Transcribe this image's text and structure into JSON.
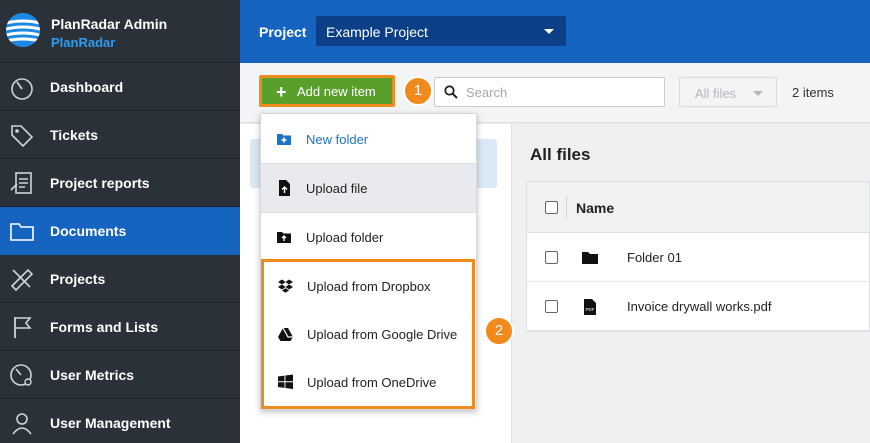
{
  "app": {
    "name": "PlanRadar Admin",
    "sub": "PlanRadar"
  },
  "sidebar": {
    "items": [
      {
        "label": "Dashboard",
        "icon": "gauge-icon"
      },
      {
        "label": "Tickets",
        "icon": "tag-icon"
      },
      {
        "label": "Project reports",
        "icon": "report-icon"
      },
      {
        "label": "Documents",
        "icon": "folder-icon",
        "active": true
      },
      {
        "label": "Projects",
        "icon": "ruler-pencil-icon"
      },
      {
        "label": "Forms and Lists",
        "icon": "flag-icon"
      },
      {
        "label": "User Metrics",
        "icon": "user-gauge-icon"
      },
      {
        "label": "User Management",
        "icon": "user-icon"
      }
    ]
  },
  "header": {
    "project_label": "Project",
    "project_value": "Example Project"
  },
  "toolbar": {
    "add_label": "Add new item",
    "search_placeholder": "Search",
    "filter_value": "All files",
    "item_count": "2 items"
  },
  "callouts": {
    "one": "1",
    "two": "2"
  },
  "menu": {
    "items": [
      {
        "label": "New folder",
        "icon": "folder-plus-icon"
      },
      {
        "label": "Upload file",
        "icon": "file-upload-icon"
      },
      {
        "label": "Upload folder",
        "icon": "folder-upload-icon"
      },
      {
        "label": "Upload from Dropbox",
        "icon": "dropbox-icon"
      },
      {
        "label": "Upload from Google Drive",
        "icon": "google-drive-icon"
      },
      {
        "label": "Upload from OneDrive",
        "icon": "windows-icon"
      }
    ]
  },
  "files": {
    "title": "All files",
    "column_name": "Name",
    "rows": [
      {
        "name": "Folder 01",
        "icon": "folder-icon"
      },
      {
        "name": "Invoice drywall works.pdf",
        "icon": "pdf-icon"
      }
    ]
  },
  "colors": {
    "sidebar": "#2b3138",
    "brand_blue": "#1565c0",
    "accent_orange": "#f08a1c",
    "add_green": "#58a02a"
  }
}
